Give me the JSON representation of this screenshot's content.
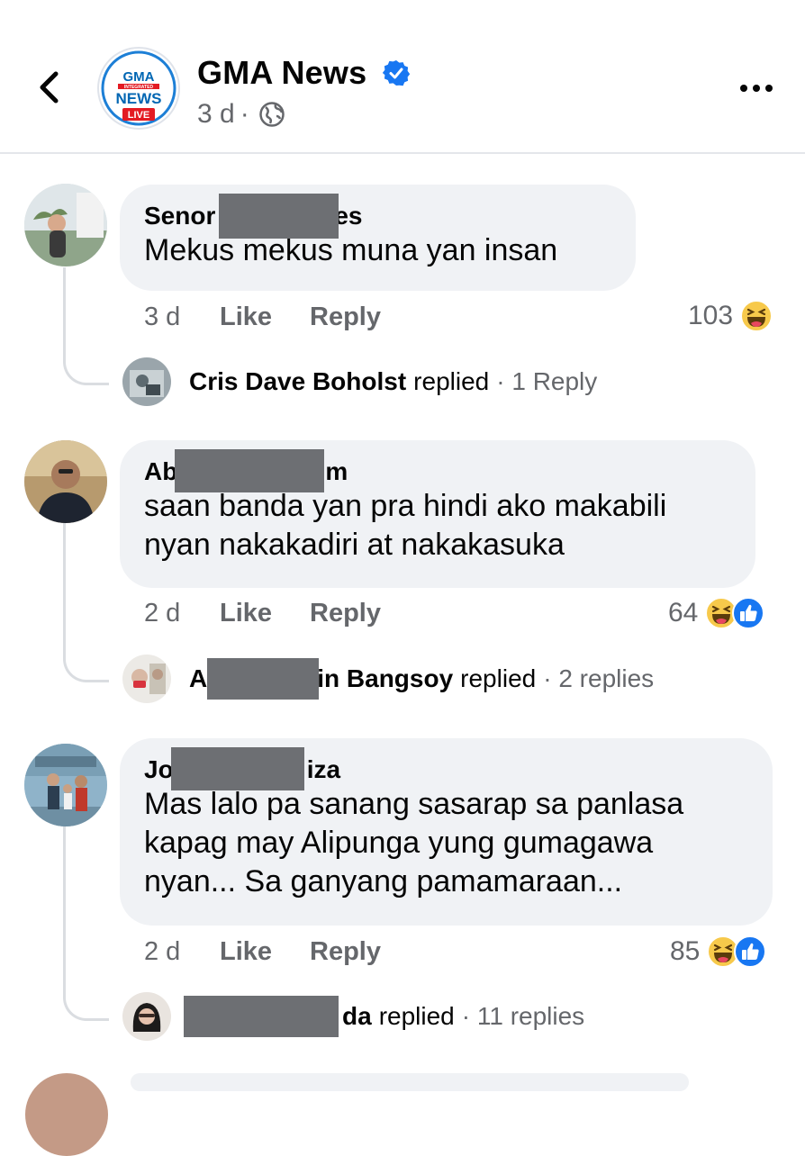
{
  "header": {
    "page_name": "GMA News",
    "logo_text": {
      "top": "GMA",
      "middle": "INTEGRATED",
      "main": "NEWS",
      "badge": "LIVE"
    },
    "time": "3 d",
    "separator": "·",
    "icons": {
      "back": "chevron-left-icon",
      "verified": "verified-badge-icon",
      "privacy": "globe-icon",
      "more": "more-dots-icon"
    },
    "colors": {
      "verified": "#1877f2",
      "logo_blue": "#0066b3",
      "logo_red": "#e31b23"
    }
  },
  "comments": [
    {
      "author_visible_start": "Senor",
      "author_visible_end": "es",
      "text": "Mekus mekus muna yan insan",
      "time": "3 d",
      "like_label": "Like",
      "reply_label": "Reply",
      "reaction_count": "103",
      "reactions": [
        "haha"
      ],
      "reply_summary": {
        "name": "Cris Dave Boholst",
        "verb": "replied",
        "count": "· 1 Reply"
      }
    },
    {
      "author_visible_start": "Ab",
      "author_visible_end": "m",
      "text": "saan banda yan pra hindi ako makabili\nnyan nakakadiri at nakakasuka",
      "time": "2 d",
      "like_label": "Like",
      "reply_label": "Reply",
      "reaction_count": "64",
      "reactions": [
        "haha",
        "like"
      ],
      "reply_summary": {
        "name_visible_start": "A",
        "name_visible_end": "in Bangsoy",
        "verb": "replied",
        "count": "· 2 replies"
      }
    },
    {
      "author_visible_start": "Jo",
      "author_visible_end": "iza",
      "text": "Mas lalo pa sanang sasarap sa panlasa\nkapag may Alipunga yung gumagawa\nnyan... Sa ganyang pamamaraan...",
      "time": "2 d",
      "like_label": "Like",
      "reply_label": "Reply",
      "reaction_count": "85",
      "reactions": [
        "haha",
        "like"
      ],
      "reply_summary": {
        "name_visible_end": "da",
        "verb": "replied",
        "count": "· 11 replies"
      }
    }
  ],
  "colors": {
    "bubble_bg": "#f0f2f5",
    "secondary_text": "#65676b",
    "redaction": "#6d6f73",
    "haha_yellow": "#f7c94b",
    "like_blue": "#1877f2"
  }
}
